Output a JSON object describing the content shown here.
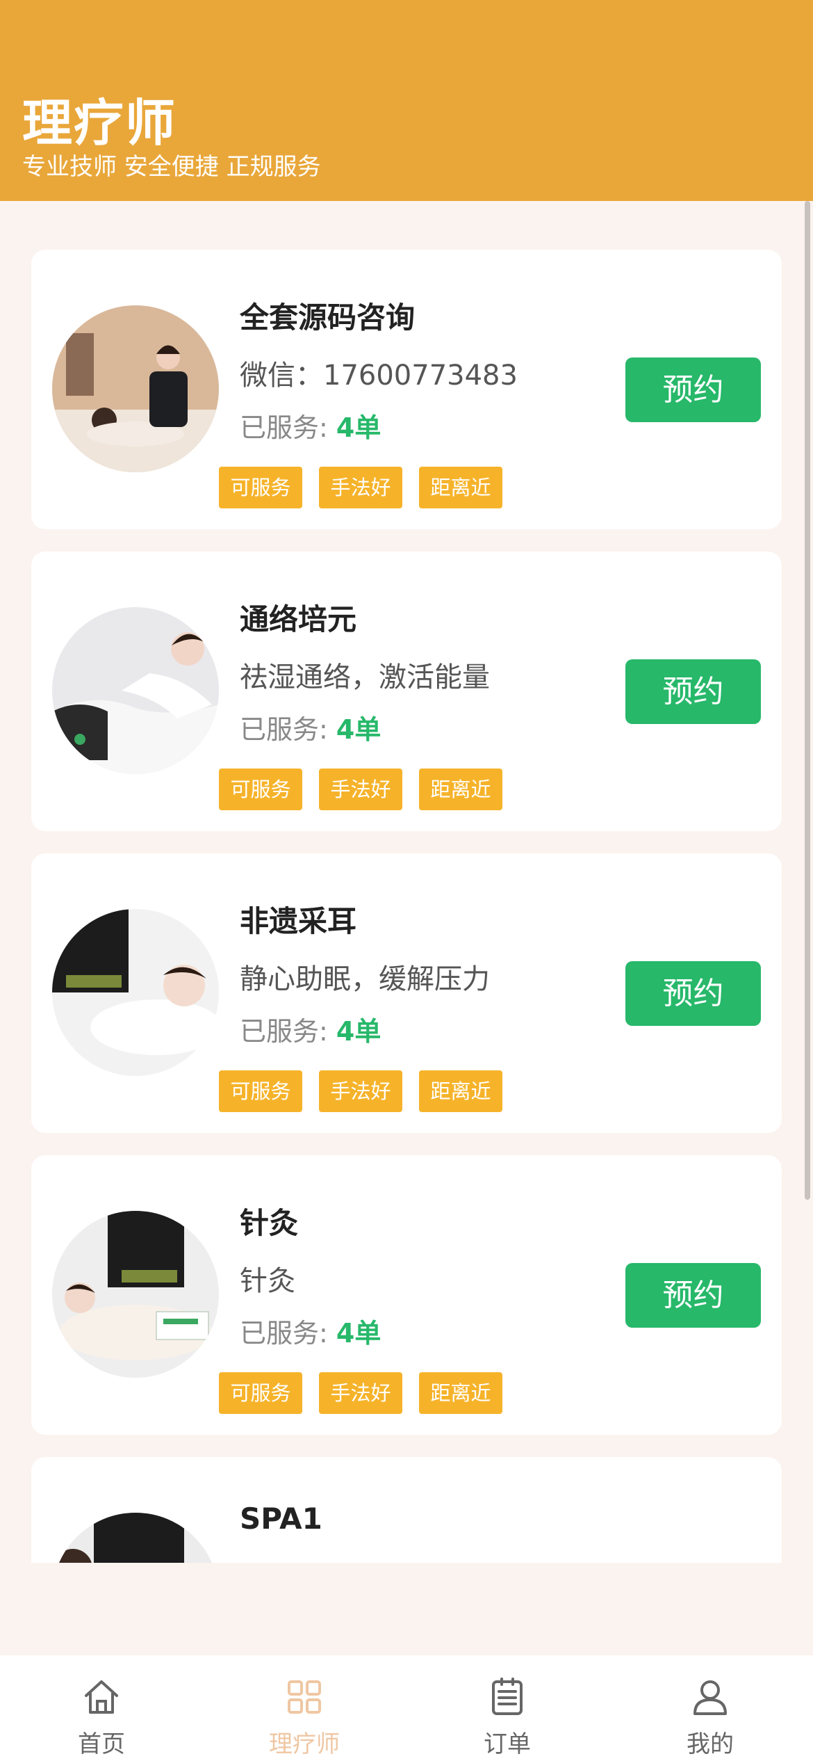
{
  "header": {
    "title": "理疗师",
    "subtitle": "专业技师 安全便捷 正规服务"
  },
  "therapists": [
    {
      "name": "全套源码咨询",
      "description": "微信：17600773483",
      "served_label": "已服务:",
      "served_count": "4单",
      "tags": [
        "可服务",
        "手法好",
        "距离近"
      ],
      "book_label": "预约"
    },
    {
      "name": "通络培元",
      "description": "祛湿通络，激活能量",
      "served_label": "已服务:",
      "served_count": "4单",
      "tags": [
        "可服务",
        "手法好",
        "距离近"
      ],
      "book_label": "预约"
    },
    {
      "name": "非遗采耳",
      "description": "静心助眠，缓解压力",
      "served_label": "已服务:",
      "served_count": "4单",
      "tags": [
        "可服务",
        "手法好",
        "距离近"
      ],
      "book_label": "预约"
    },
    {
      "name": "针灸",
      "description": "针灸",
      "served_label": "已服务:",
      "served_count": "4单",
      "tags": [
        "可服务",
        "手法好",
        "距离近"
      ],
      "book_label": "预约"
    },
    {
      "name": "SPA1",
      "description": "",
      "served_label": "",
      "served_count": "",
      "tags": [],
      "book_label": ""
    }
  ],
  "tabbar": {
    "items": [
      {
        "label": "首页",
        "icon": "home-icon"
      },
      {
        "label": "理疗师",
        "icon": "grid-icon",
        "active": true
      },
      {
        "label": "订单",
        "icon": "order-icon"
      },
      {
        "label": "我的",
        "icon": "user-icon"
      }
    ]
  },
  "colors": {
    "header": "#e9a73a",
    "accent_green": "#27b86a",
    "tag": "#f6b32a",
    "active_tab": "#efc7a3"
  }
}
